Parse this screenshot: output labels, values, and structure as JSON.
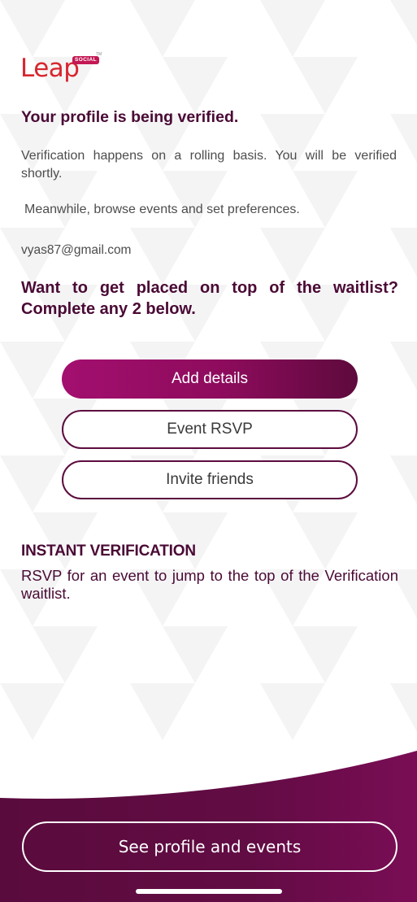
{
  "logo": {
    "text": "Leap",
    "badge": "SOCIAL",
    "tm": "TM"
  },
  "verification": {
    "title": "Your profile is being verified.",
    "paragraph1": "Verification happens on a rolling basis. You will be verified shortly.",
    "paragraph2": "Meanwhile, browse events and set preferences.",
    "email": "vyas87@gmail.com"
  },
  "waitlist": {
    "heading": "Want to get placed on top of the waitlist? Complete any 2 below.",
    "buttons": {
      "add_details": "Add details",
      "event_rsvp": "Event RSVP",
      "invite_friends": "Invite friends"
    }
  },
  "instant": {
    "heading": "INSTANT VERIFICATION",
    "text": "RSVP for an event to jump to the top of the Verification waitlist."
  },
  "footer": {
    "cta": "See profile and events"
  },
  "colors": {
    "brand_dark": "#4a0a35",
    "brand_primary": "#a30f6f",
    "logo_red": "#d8252e"
  }
}
